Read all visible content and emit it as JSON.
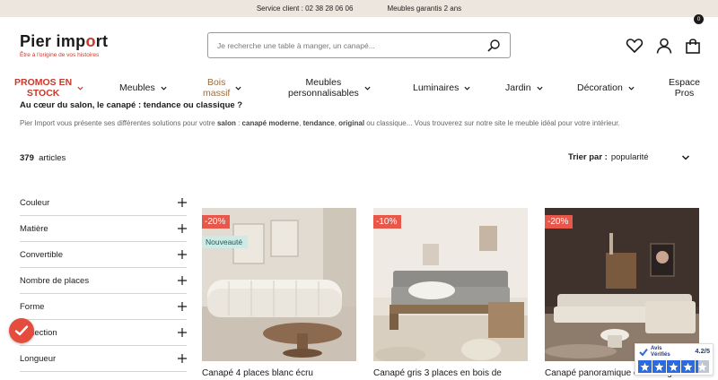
{
  "topbar": {
    "service": "Service client : 02 38 28 06 06",
    "guarantee": "Meubles garantis 2 ans"
  },
  "brand": {
    "name_a": "Pier imp",
    "name_o": "o",
    "name_b": "rt",
    "tagline": "Être à l'origine de vos histoires",
    "accent": "#c8392b"
  },
  "search": {
    "placeholder": "Je recherche une table à manger, un canapé..."
  },
  "header_icons": [
    "heart-icon",
    "user-icon",
    "bag-icon"
  ],
  "cart": {
    "count": "0"
  },
  "nav": [
    {
      "line1": "PROMOS EN",
      "line2": "STOCK"
    },
    {
      "line1": "Meubles",
      "line2": ""
    },
    {
      "line1": "Bois",
      "line2": "massif"
    },
    {
      "line1": "Meubles",
      "line2": "personnalisables"
    },
    {
      "line1": "Luminaires",
      "line2": ""
    },
    {
      "line1": "Jardin",
      "line2": ""
    },
    {
      "line1": "Décoration",
      "line2": ""
    },
    {
      "line1": "Espace",
      "line2": "Pros"
    }
  ],
  "content": {
    "title": "Au cœur du salon, le canapé : tendance ou classique ?",
    "intro_1": "Pier Import vous présente ses différentes solutions pour votre ",
    "intro_salon": "salon",
    "intro_2": " : ",
    "intro_moderne": "canapé moderne",
    "intro_3": ", ",
    "intro_tendance": "tendance",
    "intro_4": ", ",
    "intro_original": "original",
    "intro_5": " ou classique... Vous trouverez sur notre site le meuble idéal pour votre intérieur."
  },
  "listing": {
    "count": "379",
    "count_label": "articles",
    "sort_label": "Trier par :",
    "sort_value": "popularité"
  },
  "filters": [
    "Couleur",
    "Matière",
    "Convertible",
    "Nombre de places",
    "Forme",
    "Collection",
    "Longueur"
  ],
  "products": [
    {
      "discount": "-20%",
      "tag": "Nouveauté",
      "title": "Canapé 4 places blanc écru"
    },
    {
      "discount": "-10%",
      "tag": "",
      "title": "Canapé gris 3 places en bois de"
    },
    {
      "discount": "-20%",
      "tag": "",
      "title": "Canapé panoramique en U beige"
    }
  ],
  "avis": {
    "name_1": "Avis",
    "name_2": "Vérifiés",
    "score": "4.2/5",
    "rating": 4.2
  },
  "colors": {
    "topbar_bg": "#ece6de",
    "discount": "#e8584a",
    "new_badge": "#cfe9e5",
    "bois": "#9c6b3f"
  }
}
